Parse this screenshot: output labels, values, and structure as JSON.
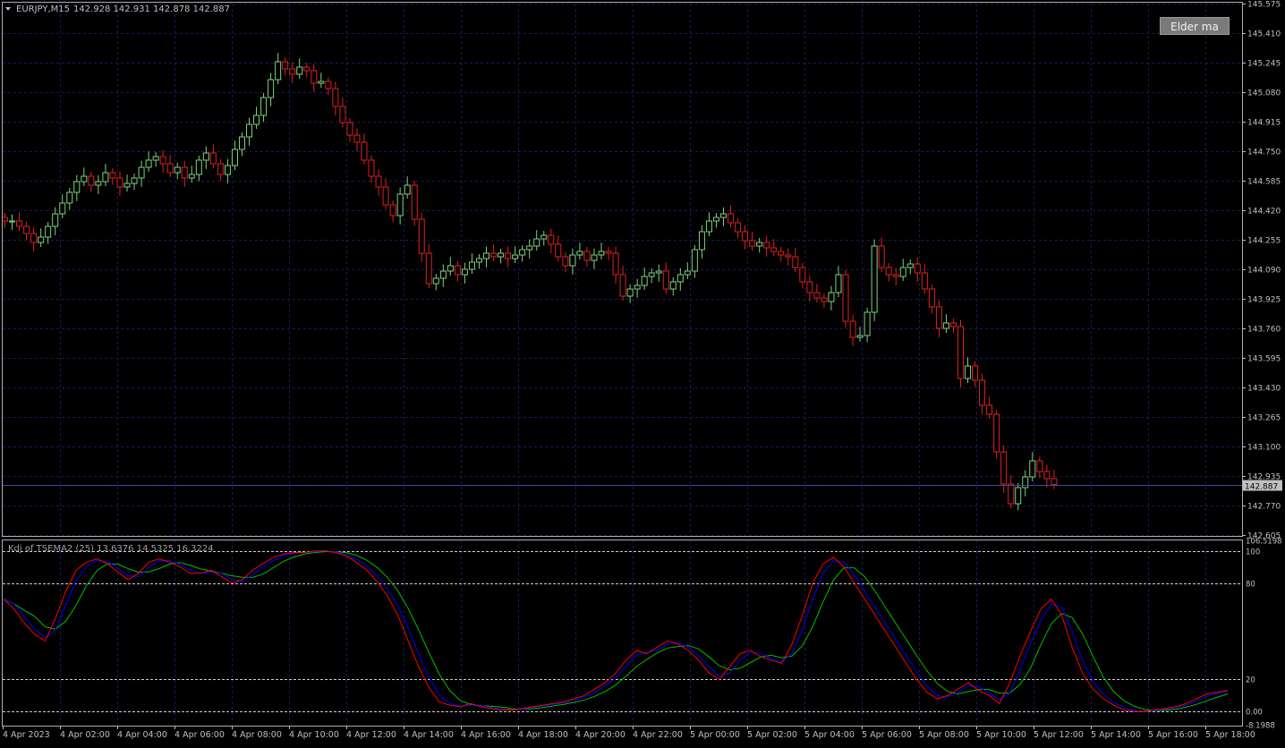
{
  "main_chart": {
    "symbol_label": "EURJPY,M15",
    "ohlc_text": "142.928 142.931 142.878 142.887",
    "current_price_label": "142.887",
    "price_axis_labels": [
      "145.575",
      "145.410",
      "145.245",
      "145.080",
      "144.915",
      "144.750",
      "144.585",
      "144.420",
      "144.255",
      "144.090",
      "143.925",
      "143.760",
      "143.595",
      "143.430",
      "143.265",
      "143.100",
      "142.935",
      "142.770",
      "142.605"
    ],
    "button_label": "Elder ma"
  },
  "indicator": {
    "title": "Kdj of TSEMA2 (25) 13.6376 14.5325 16.3224",
    "axis_labels": [
      "106.5198",
      "100",
      "80",
      "20",
      "0.00",
      "-8.1988"
    ],
    "series_colors": {
      "k": "#ff0000",
      "d": "#0000ff",
      "j": "#00c000"
    }
  },
  "time_axis_labels": [
    "4 Apr 2023",
    "4 Apr 02:00",
    "4 Apr 04:00",
    "4 Apr 06:00",
    "4 Apr 08:00",
    "4 Apr 10:00",
    "4 Apr 12:00",
    "4 Apr 14:00",
    "4 Apr 16:00",
    "4 Apr 18:00",
    "4 Apr 20:00",
    "4 Apr 22:00",
    "5 Apr 00:00",
    "5 Apr 02:00",
    "5 Apr 04:00",
    "5 Apr 06:00",
    "5 Apr 08:00",
    "5 Apr 10:00",
    "5 Apr 12:00",
    "5 Apr 14:00",
    "5 Apr 16:00",
    "5 Apr 18:00"
  ],
  "colors": {
    "bull": "#7ed27e",
    "bear": "#e02020",
    "grid": "#1a1a5e",
    "axis": "#c0c0c0",
    "price_line": "#3a4ea0"
  },
  "chart_data": {
    "type": "candlestick",
    "title": "EURJPY,M15",
    "timeframe_minutes": 15,
    "ylim": [
      142.605,
      145.575
    ],
    "closes": [
      144.36,
      144.36,
      144.33,
      144.29,
      144.24,
      144.27,
      144.33,
      144.4,
      144.46,
      144.52,
      144.58,
      144.61,
      144.56,
      144.58,
      144.63,
      144.6,
      144.55,
      144.57,
      144.6,
      144.66,
      144.7,
      144.72,
      144.68,
      144.63,
      144.66,
      144.6,
      144.62,
      144.7,
      144.74,
      144.68,
      144.62,
      144.67,
      144.76,
      144.83,
      144.9,
      144.95,
      145.05,
      145.15,
      145.25,
      145.21,
      145.18,
      145.22,
      145.2,
      145.13,
      145.14,
      145.1,
      145.0,
      144.91,
      144.84,
      144.8,
      144.7,
      144.61,
      144.55,
      144.45,
      144.39,
      144.51,
      144.56,
      144.37,
      144.18,
      144.01,
      144.04,
      144.08,
      144.11,
      144.06,
      144.09,
      144.13,
      144.15,
      144.18,
      144.16,
      144.18,
      144.15,
      144.17,
      144.2,
      144.22,
      144.26,
      144.28,
      144.23,
      144.16,
      144.11,
      144.17,
      144.19,
      144.14,
      144.17,
      144.19,
      144.18,
      144.06,
      143.94,
      143.98,
      144.0,
      144.05,
      144.07,
      144.08,
      143.98,
      144.02,
      144.06,
      144.08,
      144.2,
      144.3,
      144.36,
      144.38,
      144.4,
      144.35,
      144.3,
      144.25,
      144.22,
      144.24,
      144.21,
      144.19,
      144.17,
      144.16,
      144.1,
      144.02,
      143.96,
      143.93,
      143.91,
      143.96,
      144.06,
      143.8,
      143.71,
      143.72,
      143.85,
      144.22,
      144.1,
      144.06,
      144.05,
      144.1,
      144.12,
      144.07,
      143.98,
      143.88,
      143.76,
      143.79,
      143.77,
      143.48,
      143.55,
      143.47,
      143.33,
      143.28,
      143.07,
      142.89,
      142.78,
      142.87,
      142.93,
      143.02,
      142.96,
      142.92,
      142.887
    ],
    "kdj": {
      "k": [
        70,
        64,
        55,
        48,
        44,
        58,
        75,
        88,
        93,
        95,
        92,
        87,
        82,
        86,
        93,
        95,
        93,
        90,
        86,
        86,
        88,
        84,
        80,
        82,
        88,
        92,
        96,
        98,
        99,
        99,
        100,
        100,
        99,
        97,
        93,
        88,
        81,
        72,
        60,
        44,
        28,
        15,
        6,
        4,
        3,
        5,
        3,
        2,
        1,
        1,
        2,
        3,
        4,
        5,
        6,
        8,
        10,
        14,
        18,
        24,
        32,
        38,
        36,
        40,
        44,
        42,
        38,
        32,
        24,
        20,
        28,
        36,
        38,
        34,
        32,
        30,
        42,
        60,
        80,
        92,
        96,
        90,
        80,
        70,
        60,
        50,
        40,
        30,
        20,
        12,
        8,
        10,
        14,
        18,
        13,
        10,
        5,
        18,
        35,
        50,
        64,
        70,
        60,
        40,
        24,
        14,
        8,
        4,
        1,
        0,
        0,
        1,
        2,
        3,
        5,
        8,
        11,
        12,
        13
      ]
    }
  }
}
